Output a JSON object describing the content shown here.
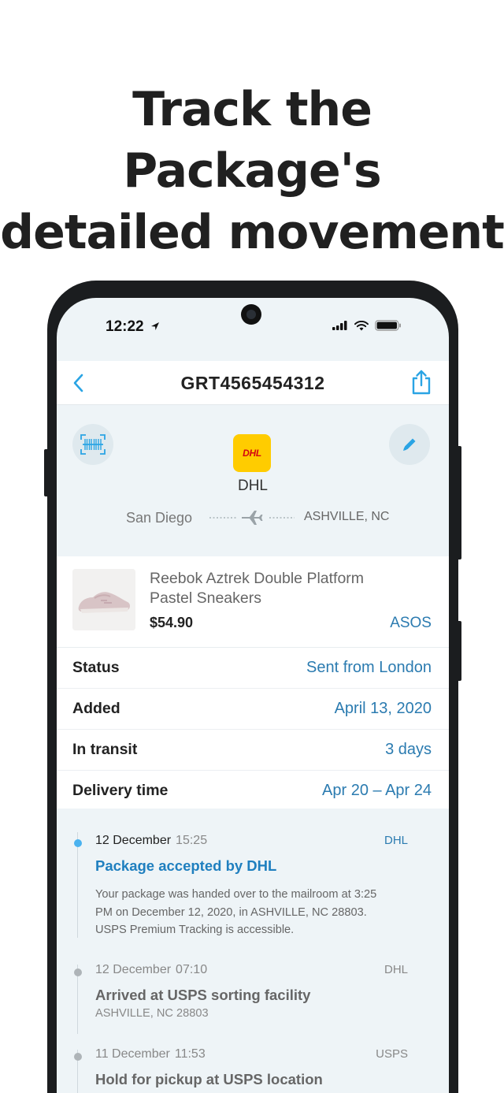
{
  "headline": {
    "line1": "Track the Package's",
    "line2": "detailed movement"
  },
  "status_bar": {
    "time": "12:22",
    "location_icon": "location-arrow-icon",
    "signal_icon": "cellular-signal-icon",
    "wifi_icon": "wifi-icon",
    "battery_icon": "battery-icon"
  },
  "nav": {
    "title": "GRT4565454312",
    "back_icon": "chevron-left-icon",
    "share_icon": "share-icon"
  },
  "carrier": {
    "logo_text": "DHL",
    "name": "DHL",
    "from": "San Diego",
    "to": "ASHVILLE, NC",
    "barcode_icon": "barcode-scan-icon",
    "edit_icon": "pencil-icon",
    "plane_icon": "airplane-icon"
  },
  "product": {
    "name": "Reebok Aztrek Double Platform Pastel Sneakers",
    "price": "$54.90",
    "store": "ASOS"
  },
  "info": [
    {
      "label": "Status",
      "value": "Sent from London"
    },
    {
      "label": "Added",
      "value": "April 13, 2020"
    },
    {
      "label": "In transit",
      "value": "3 days"
    },
    {
      "label": "Delivery time",
      "value": "Apr 20 – Apr 24"
    }
  ],
  "timeline": [
    {
      "date": "12 December",
      "time": "15:25",
      "carrier": "DHL",
      "title": "Package accepted by DHL",
      "description": "Your package was handed over to the mailroom at 3:25 PM on December 12, 2020, in ASHVILLE, NC 28803. USPS Premium Tracking is accessible."
    },
    {
      "date": "12 December",
      "time": "07:10",
      "carrier": "DHL",
      "title": "Arrived at USPS sorting facility",
      "subtitle": "ASHVILLE, NC 28803"
    },
    {
      "date": "11 December",
      "time": "11:53",
      "carrier": "USPS",
      "title": "Hold for pickup at USPS location"
    }
  ],
  "colors": {
    "accent": "#2b7bb0",
    "active_dot": "#4ab2ef",
    "dhl_yellow": "#ffcc00",
    "dhl_red": "#d40511",
    "screen_bg": "#eef4f7"
  }
}
